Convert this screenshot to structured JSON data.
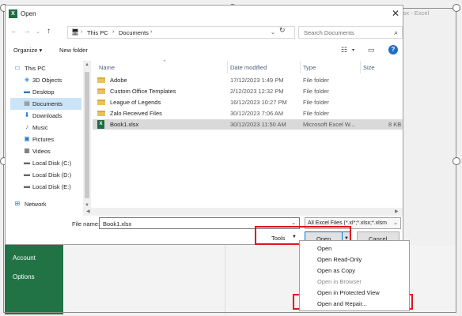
{
  "excel": {
    "title_fragment": "lsx - Excel",
    "backstage_items": [
      "Account",
      "Options"
    ]
  },
  "dialog": {
    "title": "Open",
    "close_glyph": "✕",
    "breadcrumb": [
      "This PC",
      "Documents"
    ],
    "search_placeholder": "Search Documents",
    "toolbar": {
      "organize": "Organize ▾",
      "new_folder": "New folder"
    }
  },
  "nav_pane": {
    "items": [
      {
        "label": "This PC",
        "icon": "computer-icon"
      },
      {
        "label": "3D Objects",
        "icon": "cube-icon"
      },
      {
        "label": "Desktop",
        "icon": "desktop-icon"
      },
      {
        "label": "Documents",
        "icon": "document-icon",
        "selected": true
      },
      {
        "label": "Downloads",
        "icon": "download-icon"
      },
      {
        "label": "Music",
        "icon": "music-icon"
      },
      {
        "label": "Pictures",
        "icon": "picture-icon"
      },
      {
        "label": "Videos",
        "icon": "video-icon"
      },
      {
        "label": "Local Disk (C:)",
        "icon": "drive-icon"
      },
      {
        "label": "Local Disk (D:)",
        "icon": "drive-icon"
      },
      {
        "label": "Local Disk (E:)",
        "icon": "drive-icon"
      },
      {
        "label": "Network",
        "icon": "network-icon"
      }
    ]
  },
  "file_list": {
    "columns": [
      "Name",
      "Date modified",
      "Type",
      "Size"
    ],
    "rows": [
      {
        "name": "Adobe",
        "date": "17/12/2023 1:49 PM",
        "type": "File folder",
        "size": "",
        "kind": "folder"
      },
      {
        "name": "Custom Office Templates",
        "date": "2/12/2023 12:32 PM",
        "type": "File folder",
        "size": "",
        "kind": "folder"
      },
      {
        "name": "League of Legends",
        "date": "16/12/2023 10:27 PM",
        "type": "File folder",
        "size": "",
        "kind": "folder"
      },
      {
        "name": "Zalo Received Files",
        "date": "30/12/2023 7:06 AM",
        "type": "File folder",
        "size": "",
        "kind": "folder"
      },
      {
        "name": "Book1.xlsx",
        "date": "30/12/2023 11:50 AM",
        "type": "Microsoft Excel W...",
        "size": "8 KB",
        "kind": "excel",
        "selected": true
      }
    ]
  },
  "bottom": {
    "file_name_label": "File name:",
    "file_name_value": "Book1.xlsx",
    "file_type_value": "All Excel Files (*.xl*;*.xlsx;*.xlsm",
    "tools_label": "Tools",
    "open_label": "Open",
    "cancel_label": "Cancel"
  },
  "open_menu": {
    "items": [
      {
        "label": "Open",
        "disabled": false
      },
      {
        "label": "Open Read-Only",
        "disabled": false
      },
      {
        "label": "Open as Copy",
        "disabled": false
      },
      {
        "label": "Open in Browser",
        "disabled": true
      },
      {
        "label": "Open in Protected View",
        "disabled": false
      },
      {
        "label": "Open and Repair...",
        "disabled": false,
        "highlighted": true
      }
    ]
  },
  "colors": {
    "excel_green": "#217346",
    "highlight_red": "#e0141e",
    "selection_blue": "#cce4f7"
  }
}
